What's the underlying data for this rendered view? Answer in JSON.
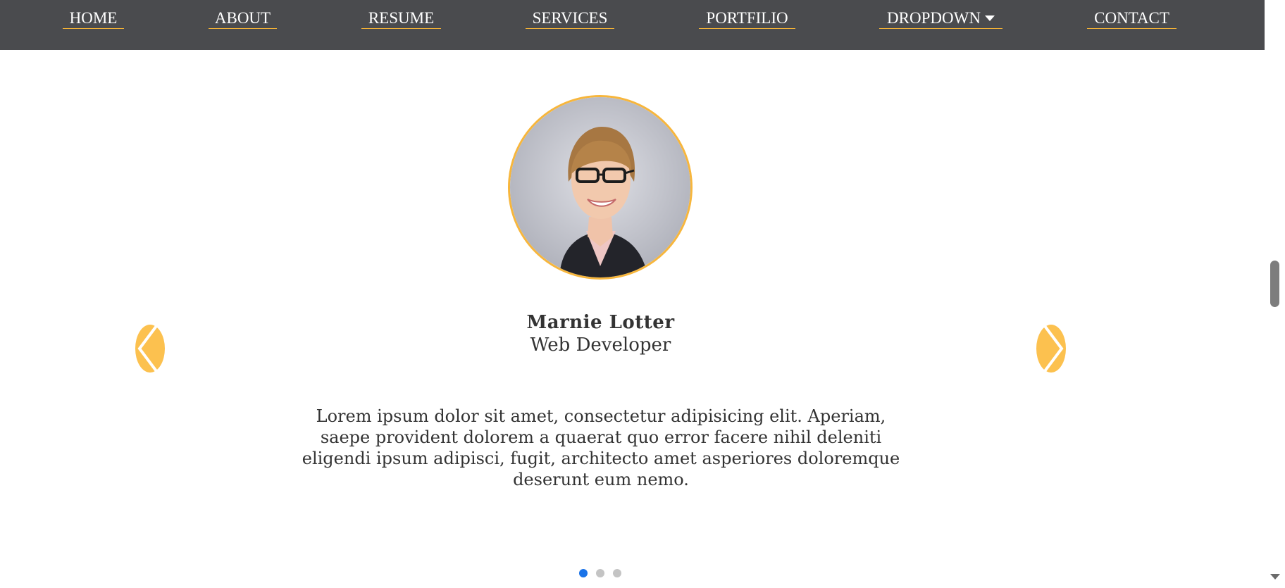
{
  "nav": {
    "items": [
      {
        "label": "HOME"
      },
      {
        "label": "ABOUT"
      },
      {
        "label": "RESUME"
      },
      {
        "label": "SERVICES"
      },
      {
        "label": "PORTFILIO"
      },
      {
        "label": "DROPDOWN"
      },
      {
        "label": "CONTACT"
      }
    ]
  },
  "testimonial": {
    "name": "Marnie Lotter",
    "role": "Web Developer",
    "quote": "Lorem ipsum dolor sit amet, consectetur adipisicing elit. Aperiam, saepe provident dolorem a quaerat quo error facere nihil deleniti eligendi ipsum adipisci, fugit, architecto amet asperiores doloremque deserunt eum nemo."
  },
  "carousel": {
    "slide_count": 3,
    "active_index": 0,
    "prev_icon": "chevron-left-icon",
    "next_icon": "chevron-right-icon"
  },
  "colors": {
    "nav_background": "#4a4b4e",
    "accent": "#f7b63c",
    "arrow": "#fcc14f",
    "dot_active": "#1a73e8",
    "dot_inactive": "#c4c4c4",
    "text": "#333333"
  }
}
